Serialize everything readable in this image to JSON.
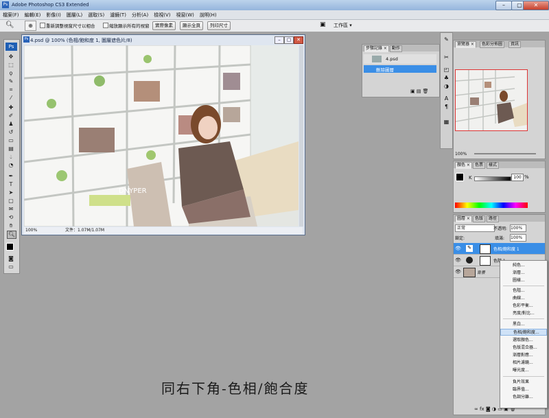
{
  "app": {
    "title": "Adobe Photoshop CS3 Extended"
  },
  "window_buttons": {
    "minimize": "–",
    "maximize": "▢",
    "close": "✕"
  },
  "menu": [
    "檔案(F)",
    "編輯(E)",
    "影像(I)",
    "圖層(L)",
    "選取(S)",
    "濾鏡(T)",
    "分析(A)",
    "檢視(V)",
    "視窗(W)",
    "說明(H)"
  ],
  "options": {
    "resize_label": "重新調整視窗尺寸以相合",
    "zoom_all_label": "縮放顯示所有的視窗",
    "actual_pixels": "實際像素",
    "fit_screen": "顯示全頁",
    "print_size": "列印尺寸",
    "workspace": "工作區 ▾"
  },
  "tools": {
    "logo": "Ps"
  },
  "document": {
    "title": "4.psd @ 100% (色相/飽和度 1, 圖層遮色片/8)",
    "zoom": "100%",
    "file_info": "文件：1.07M/1.07M",
    "watermark": "DNYPER"
  },
  "history": {
    "tabs": [
      "步驟記錄 ×",
      "動作"
    ],
    "snapshot": "4.psd",
    "state": "刪除圖層"
  },
  "navigator": {
    "tabs": [
      "瀏覽器 ×",
      "色彩分佈圖",
      "資訊"
    ],
    "zoom": "100%"
  },
  "color_panel": {
    "tabs": [
      "顏色 ×",
      "色票",
      "樣式"
    ],
    "channel": "K",
    "value": "100",
    "unit": "%"
  },
  "layers_panel": {
    "tabs": [
      "圖層 ×",
      "色版",
      "路徑"
    ],
    "blend_mode": "正常",
    "opacity_label": "不透明:",
    "opacity": "100%",
    "lock_label": "鎖定:",
    "fill_label": "填滿:",
    "fill": "100%",
    "layers": [
      "色相/飽和度 1",
      "色階 1",
      "背景"
    ]
  },
  "context_menu": {
    "items": [
      "純色...",
      "漸層...",
      "圖樣...",
      "色階...",
      "曲線...",
      "色彩平衡...",
      "亮度/對比...",
      "黑白...",
      "色相/飽和度...",
      "選取顏色...",
      "色版混合器...",
      "漸層對應...",
      "相片濾鏡...",
      "曝光度...",
      "負片效果",
      "臨界值...",
      "色調分離..."
    ],
    "highlighted": 8
  },
  "caption": "同右下角-色相/飽合度",
  "colors": {
    "accent": "#3a8ee6",
    "selection": "#cfe2f7"
  }
}
